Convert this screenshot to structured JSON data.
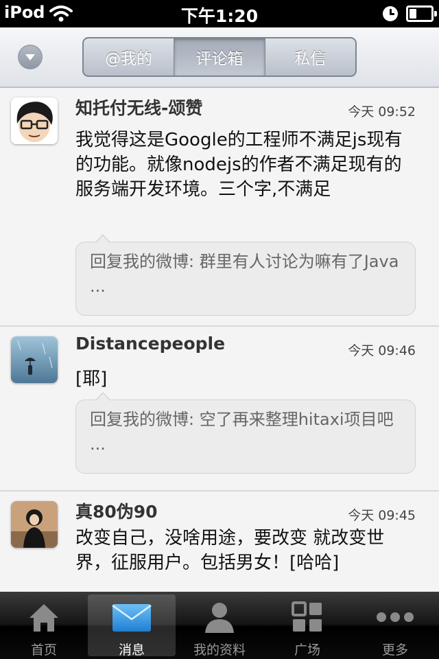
{
  "status_bar": {
    "carrier": "iPod",
    "time": "下午1:20",
    "battery_level": 0.3
  },
  "segmented_control": {
    "tabs": [
      {
        "label": "@我的",
        "active": false
      },
      {
        "label": "评论箱",
        "active": true
      },
      {
        "label": "私信",
        "active": false
      }
    ]
  },
  "feed": [
    {
      "username": "知托付无线-颂赞",
      "timestamp": "今天 09:52",
      "content": "我觉得这是Google的工程师不满足js现有的功能。就像nodejs的作者不满足现有的服务端开发环境。三个字,不满足",
      "reply": "回复我的微博: 群里有人讨论为嘛有了Java ..."
    },
    {
      "username": "Distancepeople",
      "timestamp": "今天 09:46",
      "content": "[耶]",
      "reply": "回复我的微博: 空了再来整理hitaxi项目吧 ..."
    },
    {
      "username": "真80伪90",
      "timestamp": "今天 09:45",
      "content": "改变自己，没啥用途，要改变 就改变世界，征服用户。包括男女！[哈哈]"
    }
  ],
  "tab_bar": {
    "items": [
      {
        "label": "首页",
        "icon": "home-icon",
        "active": false
      },
      {
        "label": "消息",
        "icon": "envelope-icon",
        "active": true
      },
      {
        "label": "我的资料",
        "icon": "person-icon",
        "active": false
      },
      {
        "label": "广场",
        "icon": "grid-icon",
        "active": false
      },
      {
        "label": "更多",
        "icon": "more-dots-icon",
        "active": false
      }
    ]
  },
  "colors": {
    "accent_blue": "#2f95e0",
    "feed_background": "#f4f4f4",
    "tab_bar_background": "#111111"
  }
}
